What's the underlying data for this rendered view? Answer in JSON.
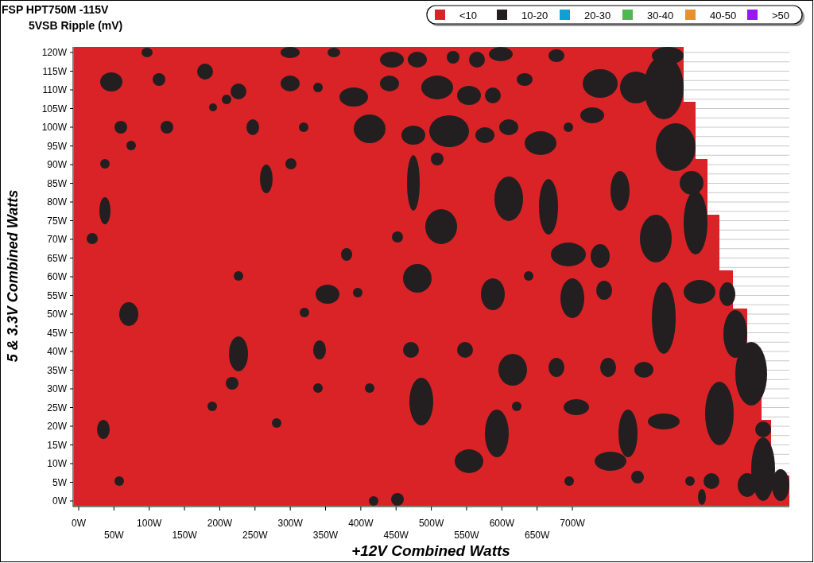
{
  "title": "FSP HPT750M -115V",
  "subtitle": "5VSB Ripple (mV)",
  "legend": [
    {
      "label": "<10",
      "color": "#d92327"
    },
    {
      "label": "10-20",
      "color": "#231f20"
    },
    {
      "label": "20-30",
      "color": "#0f9fd6"
    },
    {
      "label": "30-40",
      "color": "#4fb74f"
    },
    {
      "label": "40-50",
      "color": "#e8902a"
    },
    {
      "label": ">50",
      "color": "#9b16f5"
    }
  ],
  "y_axis": {
    "label": "5 & 3.3V Combined Watts",
    "ticks": [
      "120W",
      "115W",
      "110W",
      "105W",
      "100W",
      "95W",
      "90W",
      "85W",
      "80W",
      "75W",
      "70W",
      "65W",
      "60W",
      "55W",
      "50W",
      "45W",
      "40W",
      "35W",
      "30W",
      "25W",
      "20W",
      "15W",
      "10W",
      "5W",
      "0W"
    ]
  },
  "x_axis": {
    "label": "+12V Combined Watts",
    "ticks": [
      "0W",
      "50W",
      "100W",
      "150W",
      "200W",
      "250W",
      "300W",
      "350W",
      "400W",
      "450W",
      "500W",
      "550W",
      "600W",
      "650W",
      "700W"
    ]
  }
}
